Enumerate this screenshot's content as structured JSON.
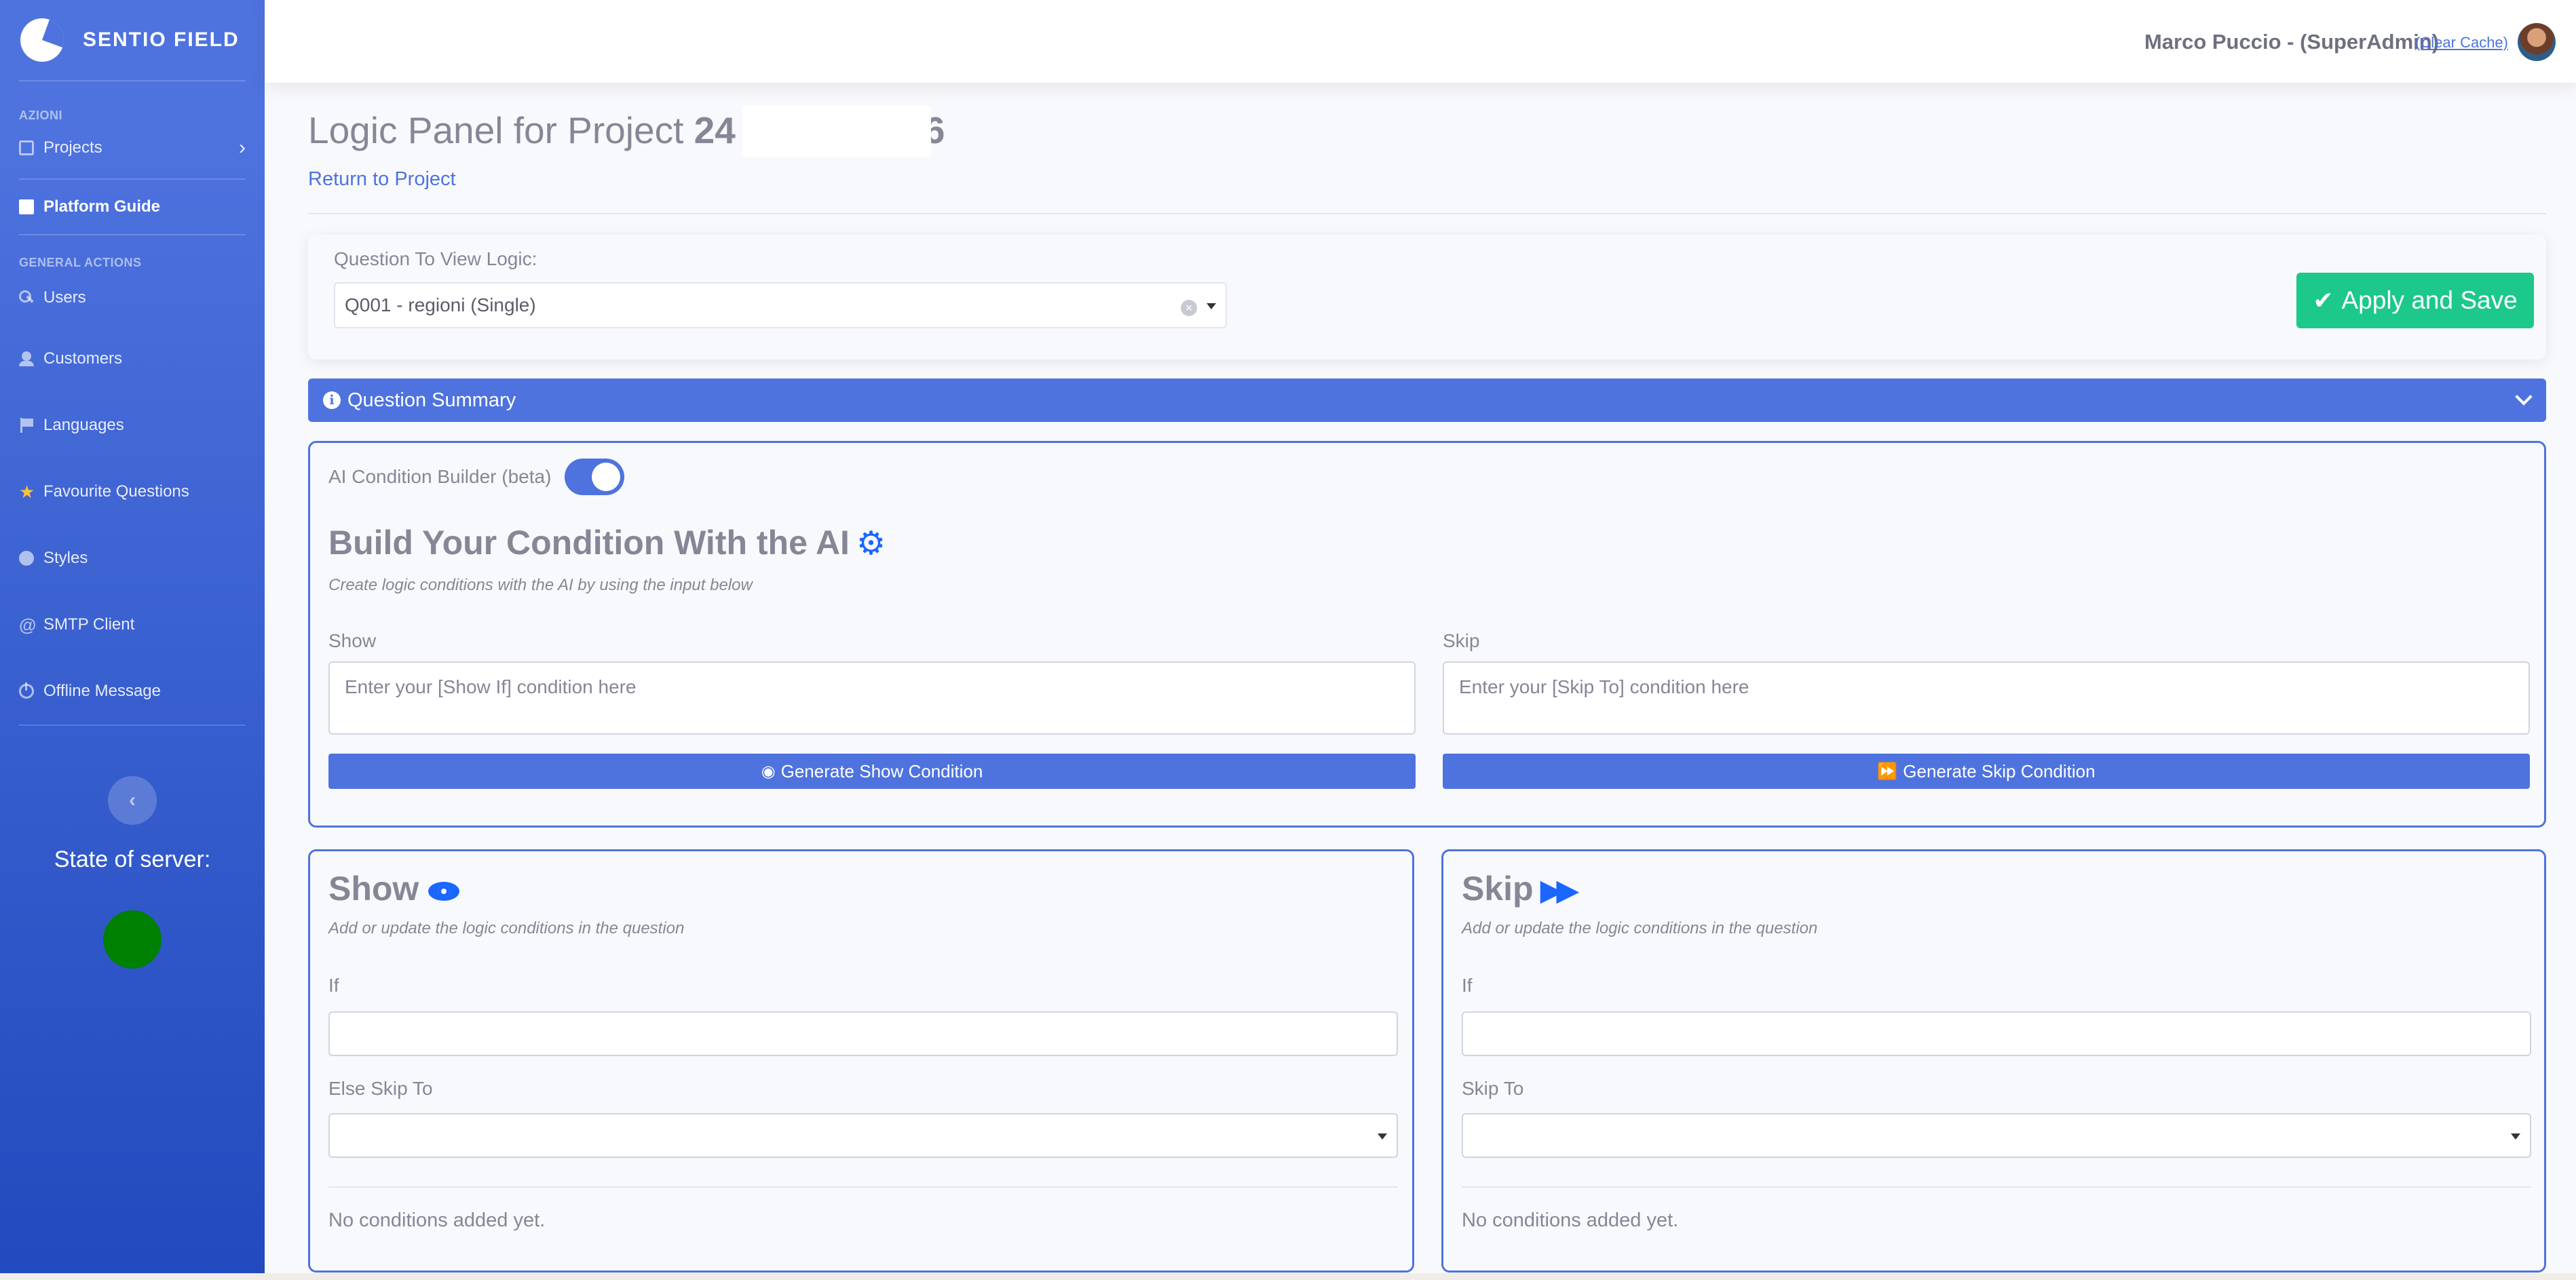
{
  "sidebar": {
    "brand": "SENTIO FIELD",
    "heading_actions": "AZIONI",
    "heading_general": "GENERAL ACTIONS",
    "items": {
      "projects": "Projects",
      "platform_guide": "Platform Guide",
      "users": "Users",
      "customers": "Customers",
      "languages": "Languages",
      "favourite_questions": "Favourite Questions",
      "styles": "Styles",
      "smtp_client": "SMTP Client",
      "offline_message": "Offline Message"
    },
    "toggle_glyph": "‹",
    "server_state_label": "State of server:",
    "server_status_color": "#008000"
  },
  "topbar": {
    "user": "Marco Puccio - (SuperAdmin)",
    "clear_cache": "(Clear Cache)"
  },
  "page": {
    "title_prefix": "Logic Panel for Project ",
    "project_id_start": "24",
    "project_id_end": "6",
    "return_link": "Return to Project"
  },
  "question_select": {
    "label": "Question To View Logic:",
    "value": "Q001 - regioni (Single)"
  },
  "apply_button": "Apply and Save",
  "question_summary": "Question Summary",
  "ai_builder": {
    "toggle_label": "AI Condition Builder (beta)",
    "toggle_on": true,
    "title": "Build Your Condition With the AI",
    "subtitle": "Create logic conditions with the AI by using the input below",
    "show_label": "Show",
    "show_placeholder": "Enter your [Show If] condition here",
    "skip_label": "Skip",
    "skip_placeholder": "Enter your [Skip To] condition here",
    "gen_show_button": "Generate Show Condition",
    "gen_skip_button": "Generate Skip Condition"
  },
  "show_panel": {
    "title": "Show",
    "subtitle": "Add or update the logic conditions in the question",
    "if_label": "If",
    "else_label": "Else Skip To",
    "empty_text": "No conditions added yet."
  },
  "skip_panel": {
    "title": "Skip",
    "subtitle": "Add or update the logic conditions in the question",
    "if_label": "If",
    "skip_to_label": "Skip To",
    "empty_text": "No conditions added yet."
  },
  "colors": {
    "primary": "#4e73df",
    "success": "#1cc88a",
    "icon_blue": "#1a66ff"
  }
}
